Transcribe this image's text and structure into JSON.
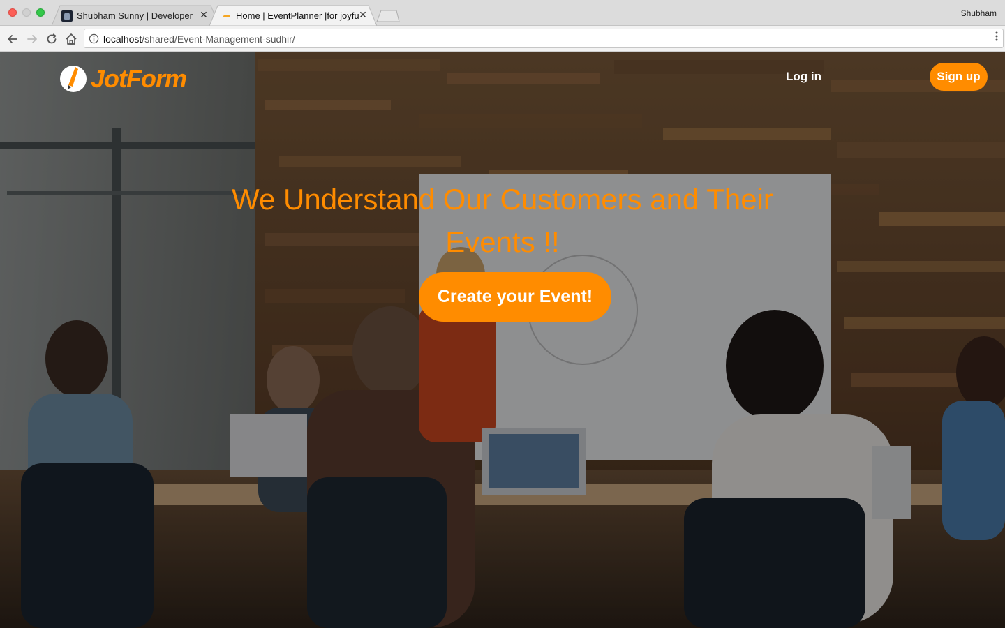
{
  "browser": {
    "tabs": [
      {
        "title": "Shubham Sunny | Developer |",
        "favicon": "profile-photo-icon",
        "active": false
      },
      {
        "title": "Home | EventPlanner |for joyful",
        "favicon": "eventplanner-favicon",
        "active": true
      }
    ],
    "profile_name": "Shubham",
    "address": {
      "host": "localhost",
      "path": "/shared/Event-Management-sudhir/"
    },
    "icons": {
      "back": "arrow-left-icon",
      "forward": "arrow-right-icon",
      "reload": "reload-icon",
      "home": "home-icon",
      "info": "info-icon",
      "menu": "vertical-dots-icon"
    }
  },
  "page": {
    "logo_text": "JotForm",
    "nav": {
      "login_label": "Log in",
      "signup_label": "Sign up"
    },
    "hero": {
      "headline": "We Understand Our Customers and Their Events !!",
      "cta_label": "Create your Event!",
      "background": "office-meeting-photo"
    }
  },
  "colors": {
    "accent": "#ff8c00",
    "nav_text": "#ffffff"
  }
}
